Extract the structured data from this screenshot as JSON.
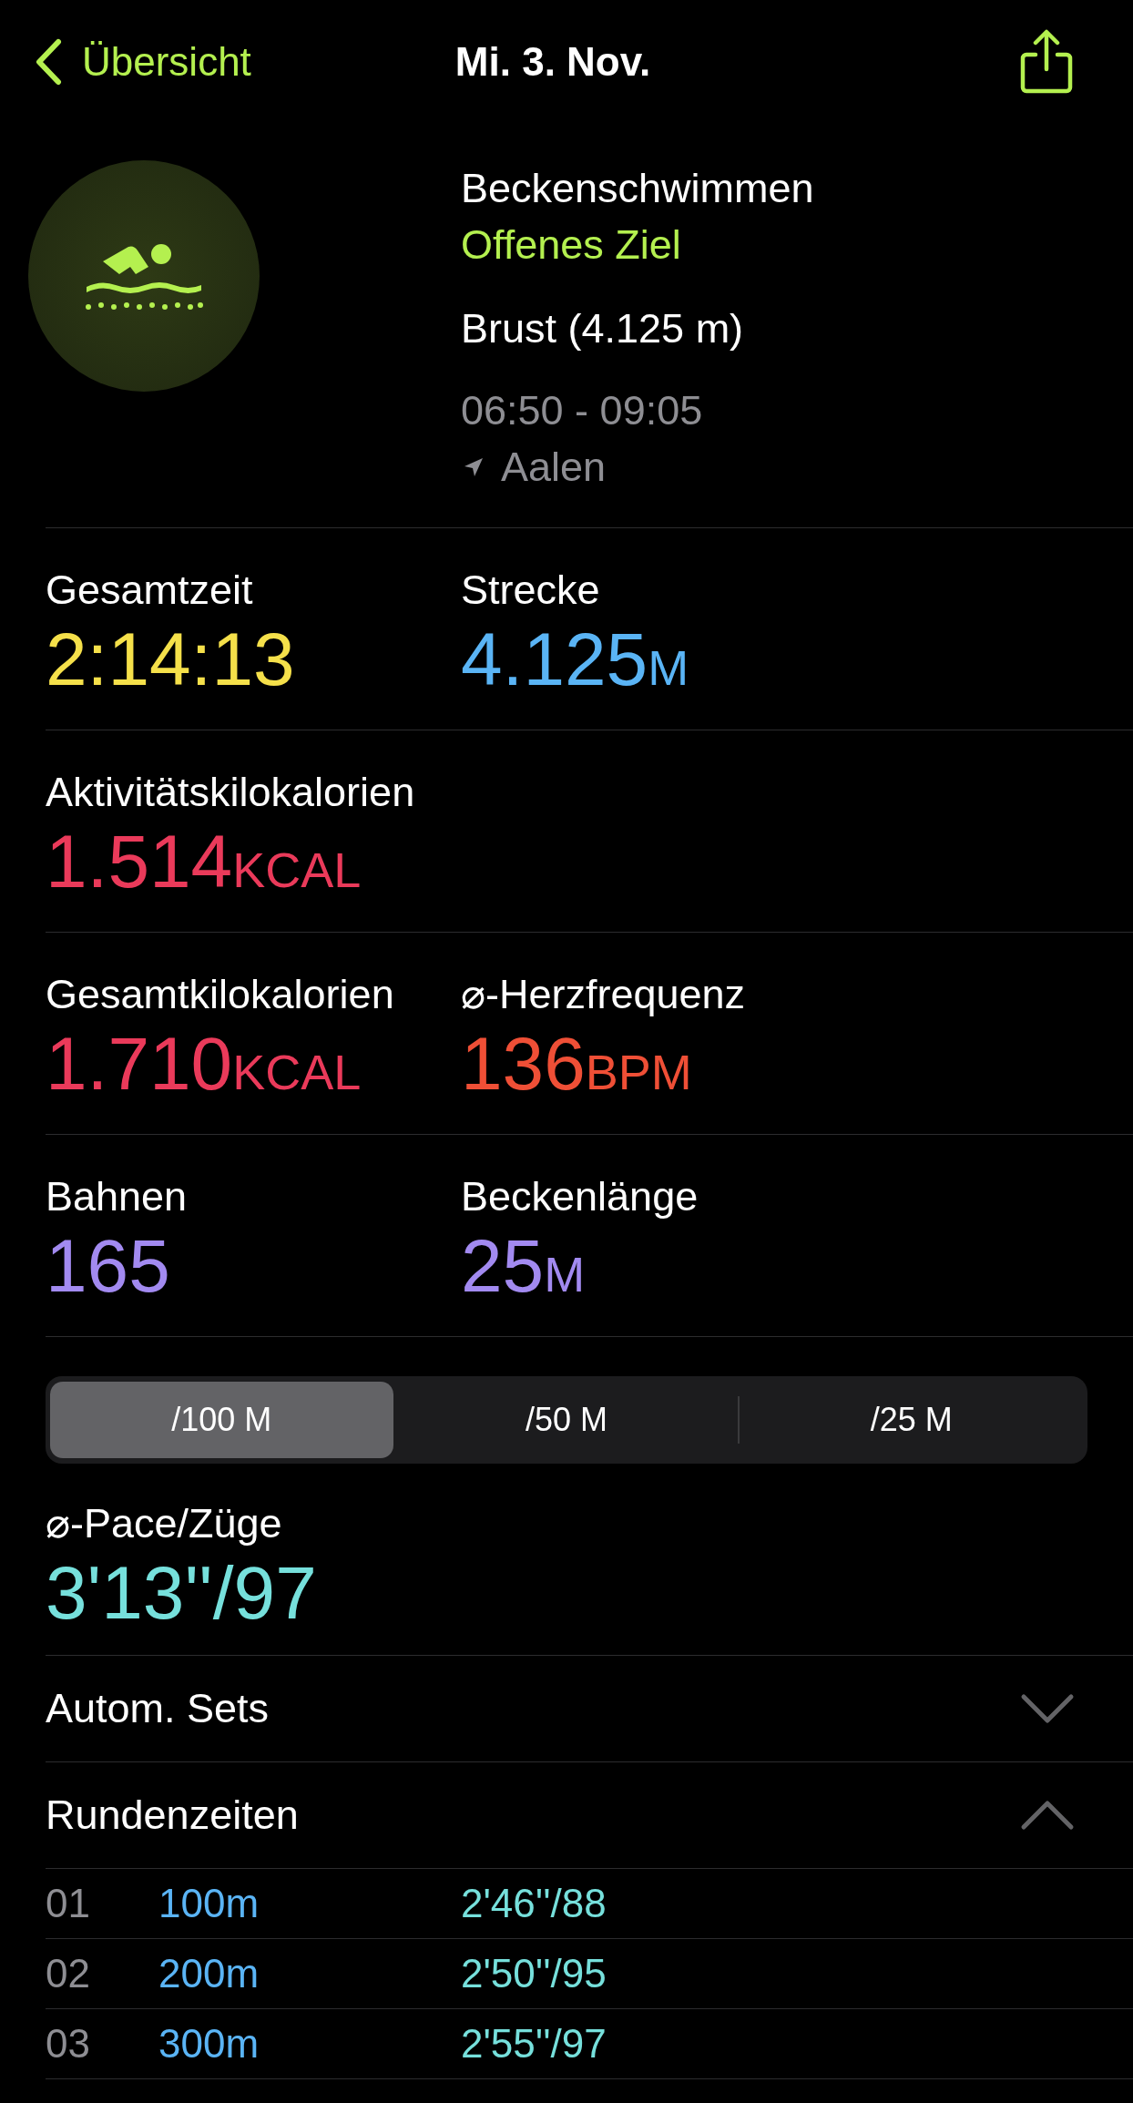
{
  "header": {
    "back_label": "Übersicht",
    "title": "Mi. 3. Nov."
  },
  "workout": {
    "name": "Beckenschwimmen",
    "goal": "Offenes Ziel",
    "detail": "Brust (4.125 m)",
    "time": "06:50 - 09:05",
    "location": "Aalen"
  },
  "stats": [
    {
      "items": [
        {
          "label": "Gesamtzeit",
          "value": "2:14:13",
          "color": "#f5e04a"
        },
        {
          "label": "Strecke",
          "value": "4.125",
          "unit": "M",
          "color": "#5ab4f5"
        }
      ]
    },
    {
      "items": [
        {
          "label": "Aktivitätskilokalorien",
          "value": "1.514",
          "unit": "KCAL",
          "color": "#ea3a5a"
        }
      ]
    },
    {
      "items": [
        {
          "label": "Gesamtkilokalorien",
          "value": "1.710",
          "unit": "KCAL",
          "color": "#ea3a5a"
        },
        {
          "label": "⌀-Herzfrequenz",
          "value": "136",
          "unit": "BPM",
          "color": "#ef4f36"
        }
      ]
    },
    {
      "items": [
        {
          "label": "Bahnen",
          "value": "165",
          "color": "#a28af0"
        },
        {
          "label": "Beckenlänge",
          "value": "25",
          "unit": "M",
          "color": "#a28af0"
        }
      ]
    }
  ],
  "segments": [
    {
      "label": "/100 M",
      "selected": true
    },
    {
      "label": "/50 M",
      "selected": false
    },
    {
      "label": "/25 M",
      "selected": false
    }
  ],
  "pace": {
    "label": "⌀-Pace/Züge",
    "value": "3'13''/97"
  },
  "sections": [
    {
      "title": "Autom. Sets",
      "expanded": false
    },
    {
      "title": "Rundenzeiten",
      "expanded": true
    }
  ],
  "laps": [
    {
      "index": "01",
      "distance": "100m",
      "pace": "2'46''/88"
    },
    {
      "index": "02",
      "distance": "200m",
      "pace": "2'50''/95"
    },
    {
      "index": "03",
      "distance": "300m",
      "pace": "2'55''/97"
    }
  ]
}
